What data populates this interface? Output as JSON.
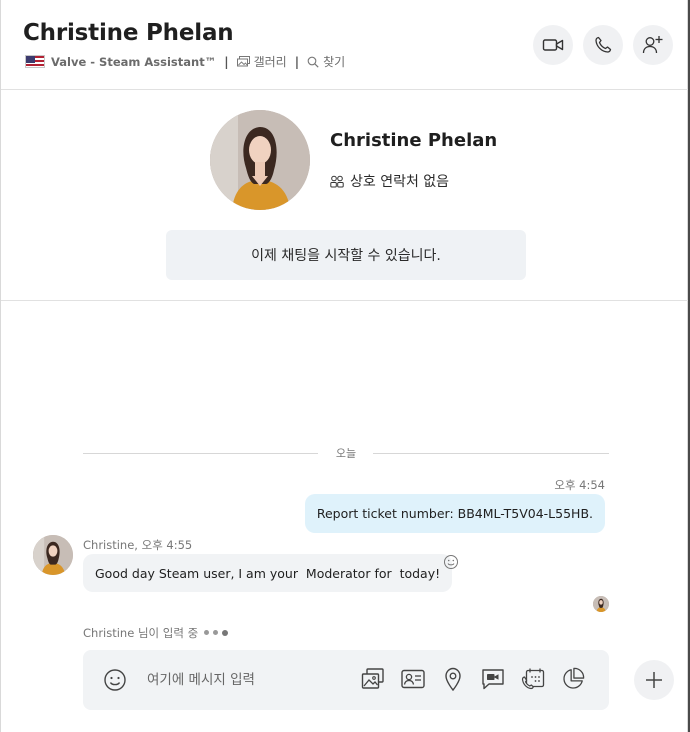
{
  "header": {
    "title": "Christine Phelan",
    "subtitle_account": "Valve - Steam Assistant™",
    "gallery_label": "갤러리",
    "find_label": "찾기",
    "buttons": [
      "video-call",
      "audio-call",
      "add-people"
    ]
  },
  "profile": {
    "name": "Christine Phelan",
    "mutual_contacts": "상호 연락처 없음",
    "start_chat": "이제 채팅을 시작할 수 있습니다."
  },
  "conversation": {
    "day_separator": "오늘",
    "outgoing": {
      "time": "오후 4:54",
      "text": "Report ticket number: BB4ML-T5V04-L55HB."
    },
    "incoming": {
      "meta": "Christine, 오후 4:55",
      "text": "Good day Steam user, I am your  Moderator for  today!"
    },
    "typing": "Christine 님이 입력 중"
  },
  "composer": {
    "placeholder": "여기에 메시지 입력",
    "tools": [
      "gallery-icon",
      "contact-card-icon",
      "location-icon",
      "video-message-icon",
      "schedule-call-icon",
      "poll-icon"
    ]
  },
  "colors": {
    "outgoing_bubble": "#dff2fb",
    "incoming_bubble": "#f1f3f5",
    "button_bg": "#f0f1f3"
  }
}
